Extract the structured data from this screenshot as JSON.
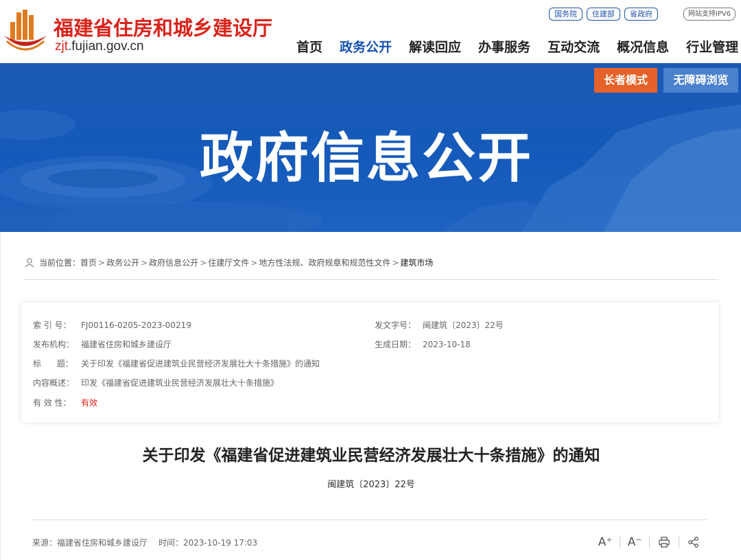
{
  "header": {
    "site_name": "福建省住房和城乡建设厅",
    "domain_main": "zjt",
    "domain_rest": ".fujian.gov.cn",
    "top_links": [
      "国务院",
      "住建部",
      "省政府"
    ],
    "ipv6_label": "网站支持IPV6",
    "nav": [
      "首页",
      "政务公开",
      "解读回应",
      "办事服务",
      "互动交流",
      "概况信息",
      "行业管理"
    ],
    "nav_active_index": 1
  },
  "banner": {
    "title": "政府信息公开",
    "elder_mode": "长者模式",
    "accessible": "无障碍浏览"
  },
  "breadcrumb": {
    "prefix": "当前位置：",
    "items": [
      "首页",
      "政务公开",
      "政府信息公开",
      "住建厅文件",
      "地方性法规、政府规章和规范性文件",
      "建筑市场"
    ],
    "separator": ">"
  },
  "meta": {
    "index_label": "索 引 号：",
    "index_value": "FJ00116-0205-2023-00219",
    "doc_no_label": "发文字号：",
    "doc_no_value": "闽建筑〔2023〕22号",
    "publisher_label": "发布机构：",
    "publisher_value": "福建省住房和城乡建设厅",
    "date_label": "生成日期：",
    "date_value": "2023-10-18",
    "title_label": "标      题：",
    "title_value": "关于印发《福建省促进建筑业民营经济发展壮大十条措施》的通知",
    "summary_label": "内容概述：",
    "summary_value": "印发《福建省促进建筑业民营经济发展壮大十条措施》",
    "validity_label": "有 效 性：",
    "validity_value": "有效"
  },
  "article": {
    "title": "关于印发《福建省促进建筑业民营经济发展壮大十条措施》的通知",
    "number": "闽建筑〔2023〕22号",
    "source": "来源：福建省住房和城乡建设厅",
    "time": "时间：2023-10-19 17:03"
  },
  "tools": {
    "font_up": "A⁺",
    "font_down": "A⁻"
  },
  "colors": {
    "brand_red": "#d9241b",
    "nav_active": "#1552b0",
    "banner_blue": "#155aba",
    "elder_orange": "#e6622a",
    "valid_red": "#e02020"
  }
}
